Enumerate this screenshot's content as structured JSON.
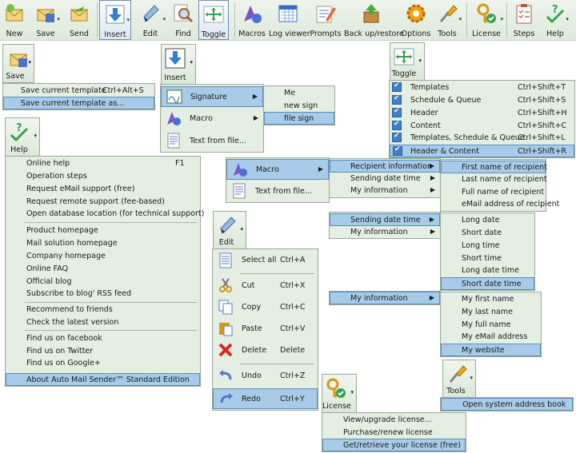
{
  "toolbar": [
    {
      "label": "New",
      "icon": "new-mail-icon"
    },
    {
      "label": "Save",
      "icon": "save-mail-icon"
    },
    {
      "label": "Send",
      "icon": "send-mail-icon"
    },
    {
      "label": "Insert",
      "icon": "insert-arrow-icon"
    },
    {
      "label": "Edit",
      "icon": "pencil-icon"
    },
    {
      "label": "Find",
      "icon": "magnifier-icon"
    },
    {
      "label": "Toggle",
      "icon": "toggle-arrows-icon"
    },
    {
      "label": "Macros",
      "icon": "macro-shapes-icon"
    },
    {
      "label": "Log viewer",
      "icon": "calendar-log-icon"
    },
    {
      "label": "Prompts",
      "icon": "prompts-pencil-icon"
    },
    {
      "label": "Back up/restore",
      "icon": "backup-box-icon"
    },
    {
      "label": "Options",
      "icon": "gear-icon"
    },
    {
      "label": "Tools",
      "icon": "screwdriver-icon"
    },
    {
      "label": "License",
      "icon": "key-check-icon"
    },
    {
      "label": "Steps",
      "icon": "clipboard-icon"
    },
    {
      "label": "Help",
      "icon": "help-check-icon"
    }
  ],
  "save": {
    "button": "Save",
    "items": [
      {
        "label": "Save current template",
        "shortcut": "Ctrl+Alt+S"
      },
      {
        "label": "Save current template as...",
        "shortcut": ""
      }
    ]
  },
  "insert": {
    "button": "Insert",
    "items": [
      {
        "label": "Signature"
      },
      {
        "label": "Macro"
      },
      {
        "label": "Text from file..."
      }
    ],
    "signature_sub": [
      "Me",
      "new sign",
      "file sign"
    ]
  },
  "toggle": {
    "button": "Toggle",
    "items": [
      {
        "label": "Templates",
        "shortcut": "Ctrl+Shift+T"
      },
      {
        "label": "Schedule & Queue",
        "shortcut": "Ctrl+Shift+S"
      },
      {
        "label": "Header",
        "shortcut": "Ctrl+Shift+H"
      },
      {
        "label": "Content",
        "shortcut": "Ctrl+Shift+C"
      },
      {
        "label": "Templates, Schedule & Queue",
        "shortcut": "Ctrl+Shift+L"
      },
      {
        "label": "Header & Content",
        "shortcut": "Ctrl+Shift+R"
      }
    ]
  },
  "help": {
    "button": "Help",
    "groups": [
      [
        {
          "label": "Online help",
          "shortcut": "F1"
        },
        {
          "label": "Operation steps"
        },
        {
          "label": "Request eMail support (free)"
        },
        {
          "label": "Request remote support (fee-based)"
        },
        {
          "label": "Open database location (for technical support)"
        }
      ],
      [
        {
          "label": "Product homepage"
        },
        {
          "label": "Mail solution homepage"
        },
        {
          "label": "Company homepage"
        },
        {
          "label": "Online FAQ"
        },
        {
          "label": "Official blog"
        },
        {
          "label": "Subscribe to blog' RSS feed"
        }
      ],
      [
        {
          "label": "Recommend to friends"
        },
        {
          "label": "Check the latest version"
        }
      ],
      [
        {
          "label": "Find us on facebook"
        },
        {
          "label": "Find us on Twitter"
        },
        {
          "label": "Find us on Google+"
        }
      ],
      [
        {
          "label": "About Auto Mail Sender™ Standard Edition"
        }
      ]
    ]
  },
  "macro_menu": {
    "items": [
      "Macro",
      "Text from file..."
    ],
    "level2": [
      "Recipient information",
      "Sending date time",
      "My information"
    ],
    "recipient": [
      "First name of recipient",
      "Last name of recipient",
      "Full name of recipient",
      "eMail address of recipient"
    ],
    "sending_menu": [
      "Sending date time",
      "My information"
    ],
    "datetime": [
      "Long date",
      "Short date",
      "Long time",
      "Short time",
      "Long date time",
      "Short date time"
    ],
    "myinfo_menu": [
      "My information"
    ],
    "myinfo": [
      "My first name",
      "My last name",
      "My full name",
      "My eMail address",
      "My website"
    ]
  },
  "edit": {
    "button": "Edit",
    "items": [
      {
        "label": "Select all",
        "shortcut": "Ctrl+A",
        "icon": "select-all-icon"
      },
      {
        "label": "Cut",
        "shortcut": "Ctrl+X",
        "icon": "scissors-icon"
      },
      {
        "label": "Copy",
        "shortcut": "Ctrl+C",
        "icon": "copy-icon"
      },
      {
        "label": "Paste",
        "shortcut": "Ctrl+V",
        "icon": "paste-icon"
      },
      {
        "label": "Delete",
        "shortcut": "Delete",
        "icon": "delete-x-icon"
      },
      {
        "label": "Undo",
        "shortcut": "Ctrl+Z",
        "icon": "undo-icon"
      },
      {
        "label": "Redo",
        "shortcut": "Ctrl+Y",
        "icon": "redo-icon"
      }
    ]
  },
  "tools": {
    "button": "Tools",
    "items": [
      "Open system address book"
    ]
  },
  "license": {
    "button": "License",
    "items": [
      "View/upgrade license...",
      "Purchase/renew license",
      "Get/retrieve your license (free)"
    ]
  }
}
